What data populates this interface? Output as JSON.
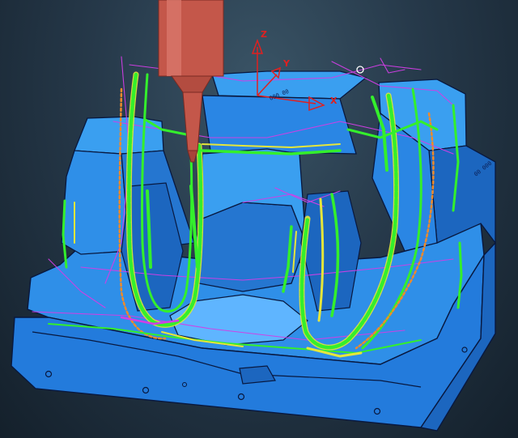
{
  "view": {
    "type": "cam-toolpath-3d-viewport",
    "colors": {
      "background": "#1f3040",
      "part_fill": "#2f8fe8",
      "part_dark": "#1c66bf",
      "part_edge": "#08183f",
      "tool_holder": "#c4574a",
      "toolpath_green": "#34ef2c",
      "toolpath_yellow": "#e6e63a",
      "toolpath_orange": "#f08a2a",
      "links_magenta": "#d23ee6",
      "axes": "#e02020"
    }
  },
  "axes_triad": {
    "z_label": "Z",
    "y_label": "Y",
    "x_label": "X"
  },
  "cursor_marker": "O",
  "part_engravings": {
    "top": "000 00",
    "side": "00 000"
  }
}
